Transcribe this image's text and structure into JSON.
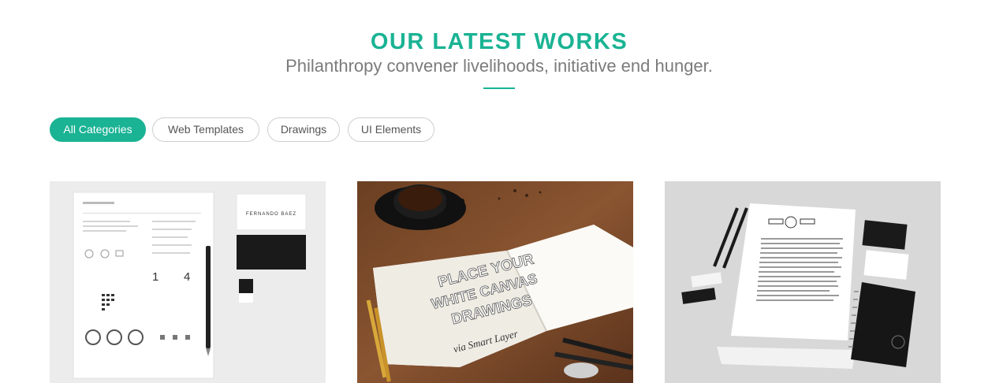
{
  "section": {
    "title": "OUR LATEST WORKS",
    "subtitle": "Philanthropy convener livelihoods, initiative end hunger.",
    "accent_color": "#1ab394"
  },
  "filters": [
    {
      "label": "All Categories",
      "active": true
    },
    {
      "label": "Web Templates",
      "active": false
    },
    {
      "label": "Drawings",
      "active": false
    },
    {
      "label": "UI Elements",
      "active": false
    }
  ],
  "works": [
    {
      "image": "resume-business-card-mockup",
      "card_name": "FERNANDO BAEZ",
      "stat_1": "1",
      "stat_2": "4"
    },
    {
      "image": "sketchbook-coffee-drawing",
      "sketch_line_1": "PLACE YOUR",
      "sketch_line_2": "WHITE CANVAS",
      "sketch_line_3": "DRAWINGS",
      "sketch_line_4": "via Smart Layer"
    },
    {
      "image": "stationery-branding-mockup"
    }
  ]
}
